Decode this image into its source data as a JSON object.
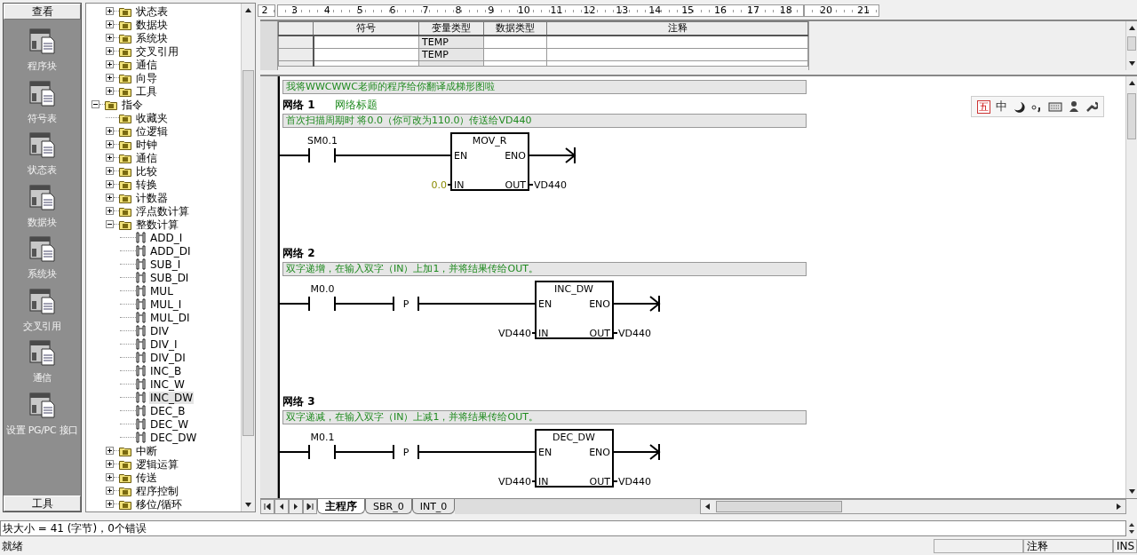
{
  "nav_bar": {
    "header": "查看",
    "items": [
      {
        "label": "程序块"
      },
      {
        "label": "符号表"
      },
      {
        "label": "状态表"
      },
      {
        "label": "数据块"
      },
      {
        "label": "系统块"
      },
      {
        "label": "交叉引用"
      },
      {
        "label": "通信"
      },
      {
        "label": "设置 PG/PC 接口"
      }
    ],
    "footer": "工具"
  },
  "tree": {
    "upper_items": [
      {
        "label": "状态表",
        "expanded": false
      },
      {
        "label": "数据块",
        "expanded": false
      },
      {
        "label": "系统块",
        "expanded": false
      },
      {
        "label": "交叉引用",
        "expanded": false
      },
      {
        "label": "通信",
        "expanded": false
      },
      {
        "label": "向导",
        "expanded": false
      },
      {
        "label": "工具",
        "expanded": false
      }
    ],
    "items": [
      {
        "label": "指令",
        "kind": "group",
        "expanded": true,
        "children": [
          {
            "label": "收藏夹",
            "kind": "empty_folder"
          },
          {
            "label": "位逻辑",
            "kind": "group",
            "expanded": false
          },
          {
            "label": "时钟",
            "kind": "group",
            "expanded": false
          },
          {
            "label": "通信",
            "kind": "group",
            "expanded": false
          },
          {
            "label": "比较",
            "kind": "group",
            "expanded": false
          },
          {
            "label": "转换",
            "kind": "group",
            "expanded": false
          },
          {
            "label": "计数器",
            "kind": "group",
            "expanded": false
          },
          {
            "label": "浮点数计算",
            "kind": "group",
            "expanded": false
          },
          {
            "label": "整数计算",
            "kind": "group",
            "expanded": true,
            "children": [
              {
                "label": "ADD_I",
                "kind": "instruction",
                "selected": false
              },
              {
                "label": "ADD_DI",
                "kind": "instruction",
                "selected": false
              },
              {
                "label": "SUB_I",
                "kind": "instruction",
                "selected": false
              },
              {
                "label": "SUB_DI",
                "kind": "instruction",
                "selected": false
              },
              {
                "label": "MUL",
                "kind": "instruction",
                "selected": false
              },
              {
                "label": "MUL_I",
                "kind": "instruction",
                "selected": false
              },
              {
                "label": "MUL_DI",
                "kind": "instruction",
                "selected": false
              },
              {
                "label": "DIV",
                "kind": "instruction",
                "selected": false
              },
              {
                "label": "DIV_I",
                "kind": "instruction",
                "selected": false
              },
              {
                "label": "DIV_DI",
                "kind": "instruction",
                "selected": false
              },
              {
                "label": "INC_B",
                "kind": "instruction",
                "selected": false
              },
              {
                "label": "INC_W",
                "kind": "instruction",
                "selected": false
              },
              {
                "label": "INC_DW",
                "kind": "instruction",
                "selected": true
              },
              {
                "label": "DEC_B",
                "kind": "instruction",
                "selected": false
              },
              {
                "label": "DEC_W",
                "kind": "instruction",
                "selected": false
              },
              {
                "label": "DEC_DW",
                "kind": "instruction",
                "selected": false
              }
            ]
          },
          {
            "label": "中断",
            "kind": "group",
            "expanded": false
          },
          {
            "label": "逻辑运算",
            "kind": "group",
            "expanded": false
          },
          {
            "label": "传送",
            "kind": "group",
            "expanded": false
          },
          {
            "label": "程序控制",
            "kind": "group",
            "expanded": false
          },
          {
            "label": "移位/循环",
            "kind": "group",
            "expanded": false
          }
        ]
      }
    ]
  },
  "ruler": {
    "sections": [
      [
        "2"
      ],
      [
        "3",
        "4",
        "5",
        "6",
        "7",
        "8",
        "9",
        "10",
        "11",
        "12",
        "13",
        "14",
        "15",
        "16",
        "17",
        "18"
      ],
      [
        "20",
        "21"
      ]
    ]
  },
  "variable_table": {
    "columns": [
      {
        "label": "符号"
      },
      {
        "label": "变量类型"
      },
      {
        "label": "数据类型"
      },
      {
        "label": "注释"
      }
    ],
    "rows": [
      {
        "var_type": "TEMP"
      },
      {
        "var_type": "TEMP"
      }
    ]
  },
  "program_comment": "我将WWCWWC老师的程序给你翻译成梯形图啦",
  "networks": [
    {
      "title": "网络 1",
      "name": "网络标题",
      "comment": "首次扫描周期时 将0.0（你可改为110.0）传送给VD440",
      "contacts": [
        {
          "kind": "normally_open",
          "label": "SM0.1"
        }
      ],
      "box": {
        "name": "MOV_R",
        "en": "EN",
        "eno": "ENO",
        "in": "IN",
        "out": "OUT",
        "in_operand": {
          "text": "0.0",
          "kind": "constant"
        },
        "out_operand": {
          "text": "VD440",
          "kind": "address"
        }
      }
    },
    {
      "title": "网络 2",
      "comment": "双字递增，在输入双字（IN）上加1，并将结果传给OUT。",
      "contacts": [
        {
          "kind": "normally_open",
          "label": "M0.0"
        },
        {
          "kind": "positive_transition",
          "label": "P"
        }
      ],
      "box": {
        "name": "INC_DW",
        "en": "EN",
        "eno": "ENO",
        "in": "IN",
        "out": "OUT",
        "in_operand": {
          "text": "VD440",
          "kind": "address"
        },
        "out_operand": {
          "text": "VD440",
          "kind": "address"
        }
      }
    },
    {
      "title": "网络 3",
      "comment": "双字递减，在输入双字（IN）上减1，并将结果传给OUT。",
      "contacts": [
        {
          "kind": "normally_open",
          "label": "M0.1"
        },
        {
          "kind": "positive_transition",
          "label": "P"
        }
      ],
      "box": {
        "name": "DEC_DW",
        "en": "EN",
        "eno": "ENO",
        "in": "IN",
        "out": "OUT",
        "in_operand": {
          "text": "VD440",
          "kind": "address"
        },
        "out_operand": {
          "text": "VD440",
          "kind": "address"
        }
      }
    }
  ],
  "ime_toolbar": {
    "scheme": "五",
    "mode": "中"
  },
  "tabs": [
    {
      "label": "主程序",
      "selected": true
    },
    {
      "label": "SBR_0",
      "selected": false
    },
    {
      "label": "INT_0",
      "selected": false
    }
  ],
  "output": "块大小 = 41 (字节)，0个错误",
  "status_bar": {
    "message": "就绪",
    "panels": [
      {
        "text": "注释"
      },
      {
        "text": "INS"
      }
    ]
  }
}
